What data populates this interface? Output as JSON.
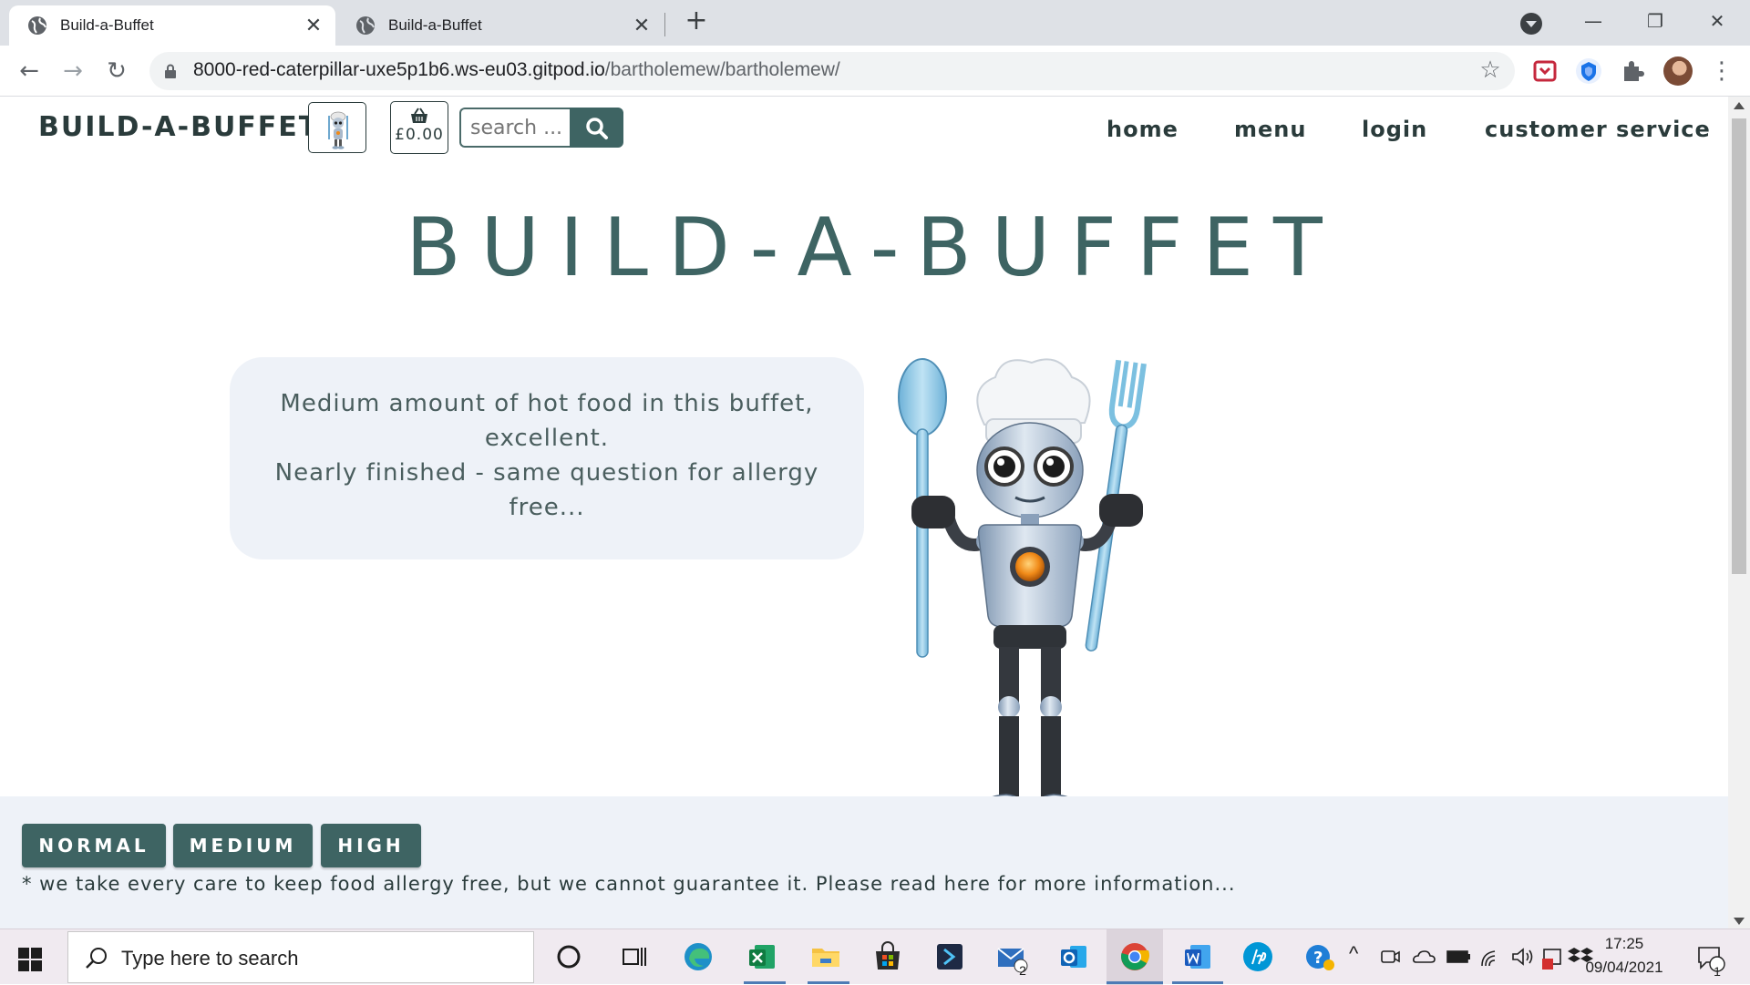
{
  "browser": {
    "tabs": [
      {
        "title": "Build-a-Buffet",
        "active": true
      },
      {
        "title": "Build-a-Buffet",
        "active": false
      }
    ],
    "url_host": "8000-red-caterpillar-uxe5p1b6.ws-eu03.gitpod.io",
    "url_path": "/bartholemew/bartholemew/"
  },
  "header": {
    "brand": "BUILD-A-BUFFET",
    "basket_total": "£0.00",
    "search_placeholder": "search ...",
    "nav": [
      {
        "label": "home"
      },
      {
        "label": "menu"
      },
      {
        "label": "login"
      },
      {
        "label": "customer service"
      }
    ]
  },
  "hero": {
    "title": "BUILD-A-BUFFET",
    "message_line1": "Medium amount of hot food in this buffet,",
    "message_line2": "excellent.",
    "message_line3": "Nearly finished - same question for allergy",
    "message_line4": "free..."
  },
  "choices": {
    "buttons": [
      {
        "label": "NORMAL"
      },
      {
        "label": "MEDIUM"
      },
      {
        "label": "HIGH"
      }
    ],
    "disclaimer": "* we take every care to keep food allergy free, but we cannot guarantee it. Please read here for more information..."
  },
  "taskbar": {
    "search_placeholder": "Type here to search",
    "mail_badge": "2",
    "notification_badge": "1",
    "time": "17:25",
    "date": "09/04/2021"
  },
  "colors": {
    "brand_teal": "#3e6463",
    "panel_bg": "#eef2f8",
    "text_dark": "#2a3b3b"
  }
}
